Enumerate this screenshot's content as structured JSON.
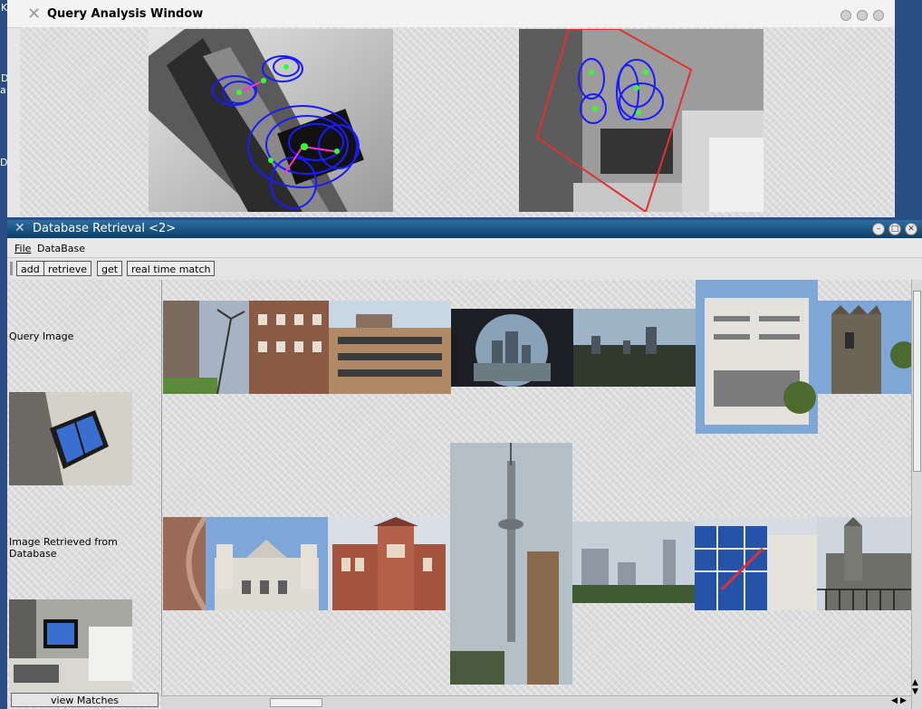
{
  "desktop": {
    "fragments": [
      "K",
      "D",
      "a",
      "De"
    ]
  },
  "query_window": {
    "title": "Query Analysis Window"
  },
  "db_window": {
    "title": "Database Retrieval <2>",
    "menu": [
      "File",
      "DataBase"
    ],
    "toolbar": {
      "add": "add",
      "retrieve": "retrieve",
      "get": "get",
      "realtime": "real time match"
    },
    "left": {
      "query_label": "Query Image",
      "retrieved_label": "Image Retrieved from Database",
      "view_matches": "view Matches"
    }
  },
  "colors": {
    "titlebar": "#0d3e66",
    "feature_ellipse": "#1a1aff",
    "feature_point": "#33ff33",
    "feature_vector": "#ff33cc",
    "match_box": "#e23030"
  }
}
